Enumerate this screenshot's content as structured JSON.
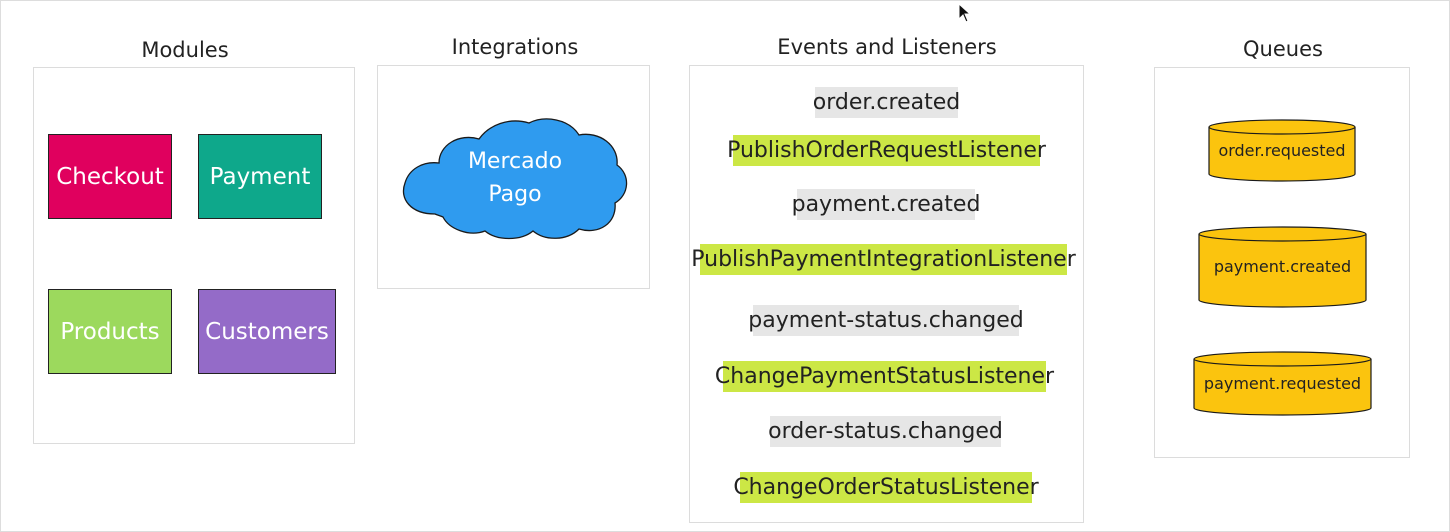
{
  "sections": {
    "modules": "Modules",
    "integrations": "Integrations",
    "events": "Events and Listeners",
    "queues": "Queues"
  },
  "modules": [
    {
      "label": "Checkout",
      "color": "#e0005e"
    },
    {
      "label": "Payment",
      "color": "#0ea88b"
    },
    {
      "label": "Products",
      "color": "#9cd95d"
    },
    {
      "label": "Customers",
      "color": "#946bc8"
    }
  ],
  "integration": {
    "line1": "Mercado",
    "line2": "Pago",
    "color": "#2f9bef"
  },
  "events_and_listeners": [
    {
      "kind": "event",
      "label": "order.created",
      "color": "#e6e6e6"
    },
    {
      "kind": "listener",
      "label": "PublishOrderRequestListener",
      "color": "#cce745"
    },
    {
      "kind": "event",
      "label": "payment.created",
      "color": "#e6e6e6"
    },
    {
      "kind": "listener",
      "label": "PublishPaymentIntegrationListener",
      "color": "#cce745"
    },
    {
      "kind": "event",
      "label": "payment-status.changed",
      "color": "#e6e6e6"
    },
    {
      "kind": "listener",
      "label": "ChangePaymentStatusListener",
      "color": "#cce745"
    },
    {
      "kind": "event",
      "label": "order-status.changed",
      "color": "#e6e6e6"
    },
    {
      "kind": "listener",
      "label": "ChangeOrderStatusListener",
      "color": "#cce745"
    }
  ],
  "queues": [
    {
      "label": "order.requested",
      "color": "#fbc40e"
    },
    {
      "label": "payment.created",
      "color": "#fbc40e"
    },
    {
      "label": "payment.requested",
      "color": "#fbc40e"
    }
  ],
  "cursor_icon": "mouse-pointer-icon"
}
